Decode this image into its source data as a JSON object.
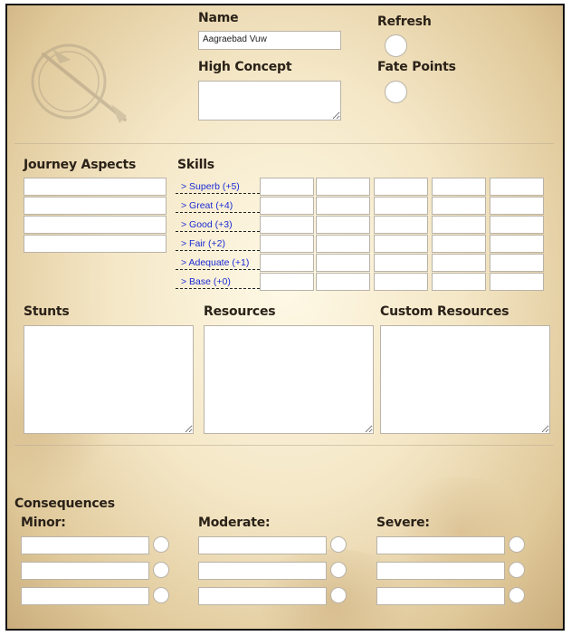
{
  "header": {
    "name_label": "Name",
    "name_value": "Aagraebad Vuw",
    "high_concept_label": "High Concept",
    "refresh_label": "Refresh",
    "fate_points_label": "Fate Points"
  },
  "journey_aspects": {
    "label": "Journey Aspects"
  },
  "skills": {
    "label": "Skills",
    "levels": [
      "> Superb (+5)",
      "> Great (+4)",
      "> Good (+3)",
      "> Fair (+2)",
      "> Adequate (+1)",
      "> Base (+0)"
    ]
  },
  "stunts": {
    "label": "Stunts"
  },
  "resources": {
    "label": "Resources"
  },
  "custom_resources": {
    "label": "Custom Resources"
  },
  "consequences": {
    "label": "Consequences",
    "minor_label": "Minor:",
    "moderate_label": "Moderate:",
    "severe_label": "Severe:"
  },
  "colors": {
    "paper": "#efe0bd",
    "link": "#1a2bd6",
    "border": "#111111"
  },
  "icons": {
    "emblem": "quill-emblem-icon"
  }
}
